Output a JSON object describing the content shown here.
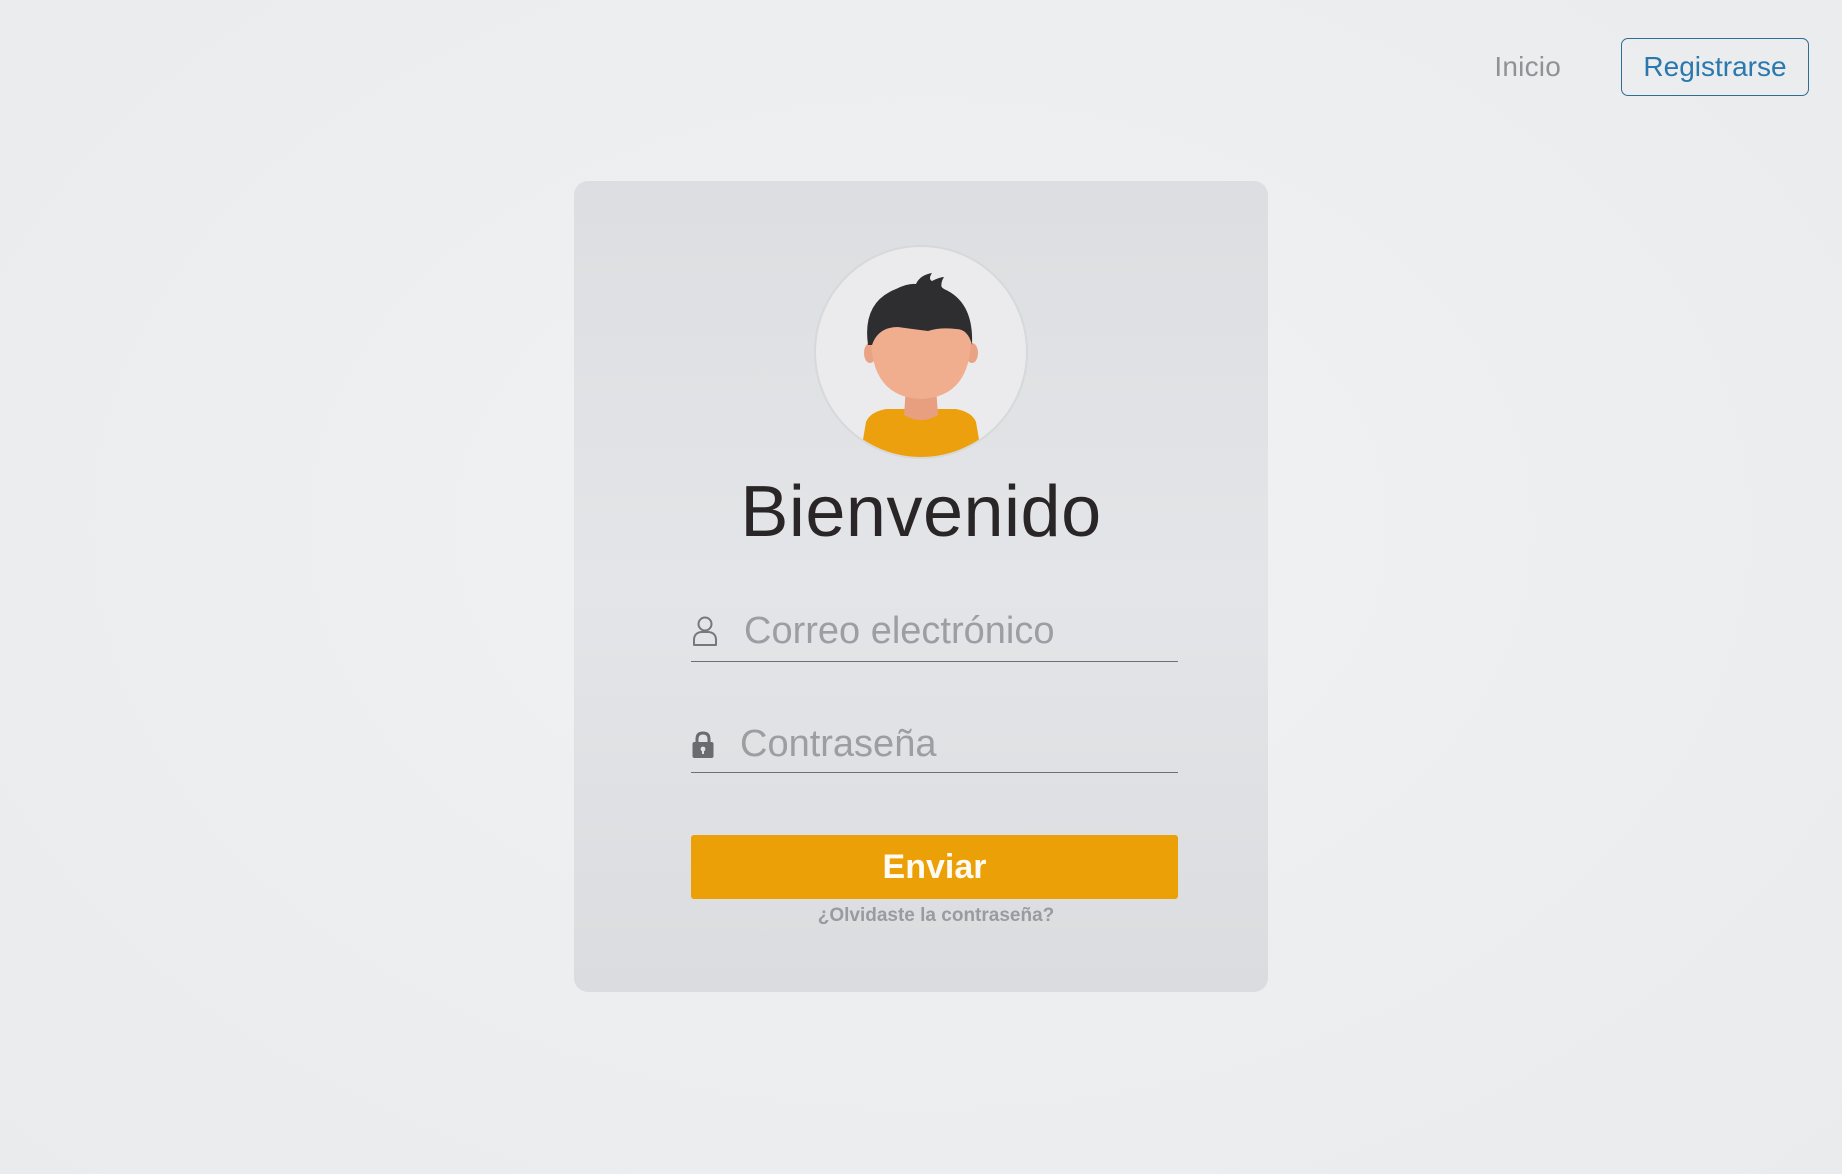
{
  "nav": {
    "home_label": "Inicio",
    "register_label": "Registrarse"
  },
  "login": {
    "title": "Bienvenido",
    "email_placeholder": "Correo electrónico",
    "password_placeholder": "Contraseña",
    "submit_label": "Enviar",
    "forgot_label": "¿Olvidaste la contraseña?",
    "avatar_icon": "user-avatar-illustration",
    "email_icon": "user-icon",
    "password_icon": "lock-icon"
  },
  "colors": {
    "accent": "#eba007",
    "link": "#2a78ad",
    "avatar_shirt": "#eda00d",
    "avatar_skin": "#f0ae8f",
    "avatar_hair": "#2e2e30"
  }
}
